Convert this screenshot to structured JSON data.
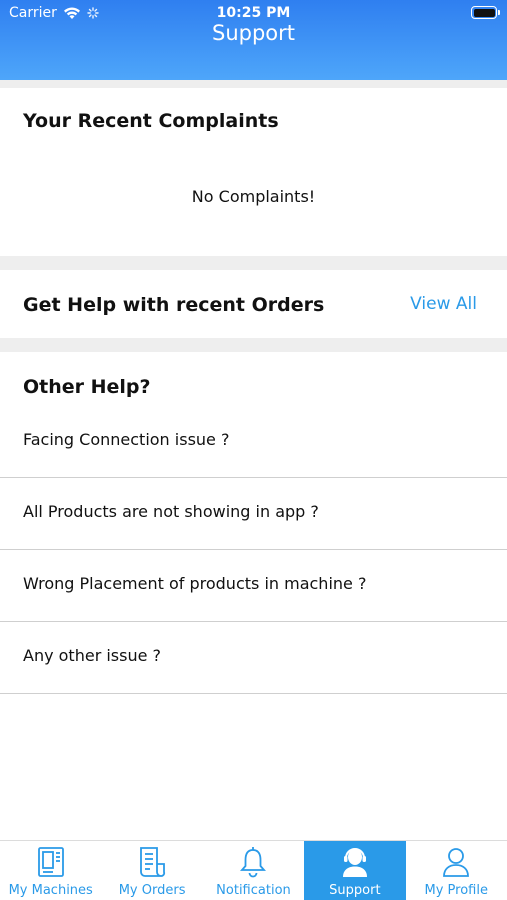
{
  "status_bar": {
    "carrier": "Carrier",
    "time": "10:25 PM"
  },
  "header": {
    "title": "Support"
  },
  "complaints": {
    "title": "Your Recent Complaints",
    "empty_text": "No Complaints!"
  },
  "orders_help": {
    "title": "Get Help with recent Orders",
    "view_all": "View All"
  },
  "other_help": {
    "title": "Other Help?",
    "items": [
      "Facing Connection issue ?",
      "All Products are not showing in app ?",
      "Wrong Placement of products in machine ?",
      "Any other issue ?"
    ]
  },
  "tabs": [
    {
      "label": "My Machines",
      "icon": "machine-icon"
    },
    {
      "label": "My Orders",
      "icon": "orders-icon"
    },
    {
      "label": "Notification",
      "icon": "bell-icon"
    },
    {
      "label": "Support",
      "icon": "support-agent-icon",
      "active": true
    },
    {
      "label": "My Profile",
      "icon": "profile-icon"
    }
  ],
  "colors": {
    "accent": "#2a9ae8",
    "header_top": "#2f7ff0",
    "header_bottom": "#4ea6fa",
    "divider": "#eeeeee"
  }
}
